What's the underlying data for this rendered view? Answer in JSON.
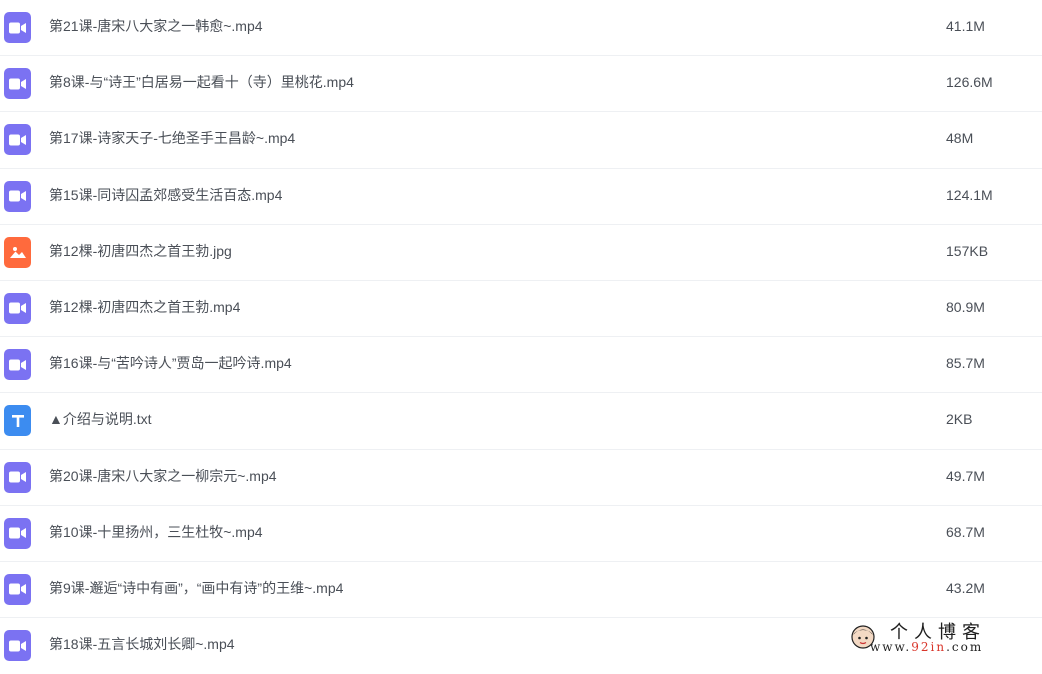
{
  "colors": {
    "video_icon": "#7b72f2",
    "image_icon": "#ff6a3d",
    "text_icon": "#3c8cf0"
  },
  "files": [
    {
      "name": "第21课-唐宋八大家之一韩愈~.mp4",
      "size": "41.1M",
      "icon": "video-icon"
    },
    {
      "name": "第8课-与“诗王”白居易一起看十（寺）里桃花.mp4",
      "size": "126.6M",
      "icon": "video-icon"
    },
    {
      "name": "第17课-诗家天子-七绝圣手王昌龄~.mp4",
      "size": "48M",
      "icon": "video-icon"
    },
    {
      "name": "第15课-同诗囚孟郊感受生活百态.mp4",
      "size": "124.1M",
      "icon": "video-icon"
    },
    {
      "name": "第12棵-初唐四杰之首王勃.jpg",
      "size": "157KB",
      "icon": "image-icon"
    },
    {
      "name": "第12棵-初唐四杰之首王勃.mp4",
      "size": "80.9M",
      "icon": "video-icon"
    },
    {
      "name": "第16课-与“苦吟诗人”贾岛一起吟诗.mp4",
      "size": "85.7M",
      "icon": "video-icon"
    },
    {
      "name": "▲介绍与说明.txt",
      "size": "2KB",
      "icon": "text-icon"
    },
    {
      "name": "第20课-唐宋八大家之一柳宗元~.mp4",
      "size": "49.7M",
      "icon": "video-icon"
    },
    {
      "name": "第10课-十里扬州，三生杜牧~.mp4",
      "size": "68.7M",
      "icon": "video-icon"
    },
    {
      "name": "第9课-邂逅“诗中有画”，“画中有诗”的王维~.mp4",
      "size": "43.2M",
      "icon": "video-icon"
    },
    {
      "name": "第18课-五言长城刘长卿~.mp4",
      "size": "",
      "icon": "video-icon"
    }
  ],
  "watermark": {
    "title": "个人博客",
    "url_prefix": "www.",
    "url_highlight": "92in",
    "url_suffix": ".com"
  }
}
